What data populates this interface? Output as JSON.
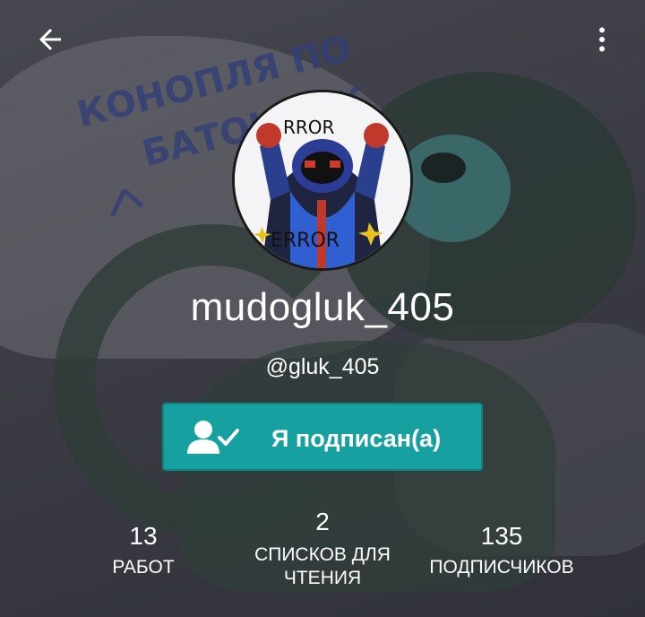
{
  "toolbar": {
    "back_icon": "arrow-left-icon",
    "more_icon": "more-vertical-icon"
  },
  "background": {
    "scribble_line1": "КОНОПЛЯ ПО",
    "scribble_line2": "БАТОНЧИК"
  },
  "profile": {
    "avatar_text_top": "RROR",
    "avatar_text_bottom": "ERROR",
    "display_name": "mudogluk_405",
    "username": "@gluk_405"
  },
  "follow_button": {
    "label": "Я подписан(а)",
    "icon": "user-check-icon",
    "color": "#17a0a0"
  },
  "stats": {
    "works": {
      "value": "13",
      "label": "РАБОТ"
    },
    "reading_lists": {
      "value": "2",
      "label_line1": "СПИСКОВ ДЛЯ",
      "label_line2": "ЧТЕНИЯ"
    },
    "followers": {
      "value": "135",
      "label": "ПОДПИСЧИКОВ"
    }
  }
}
